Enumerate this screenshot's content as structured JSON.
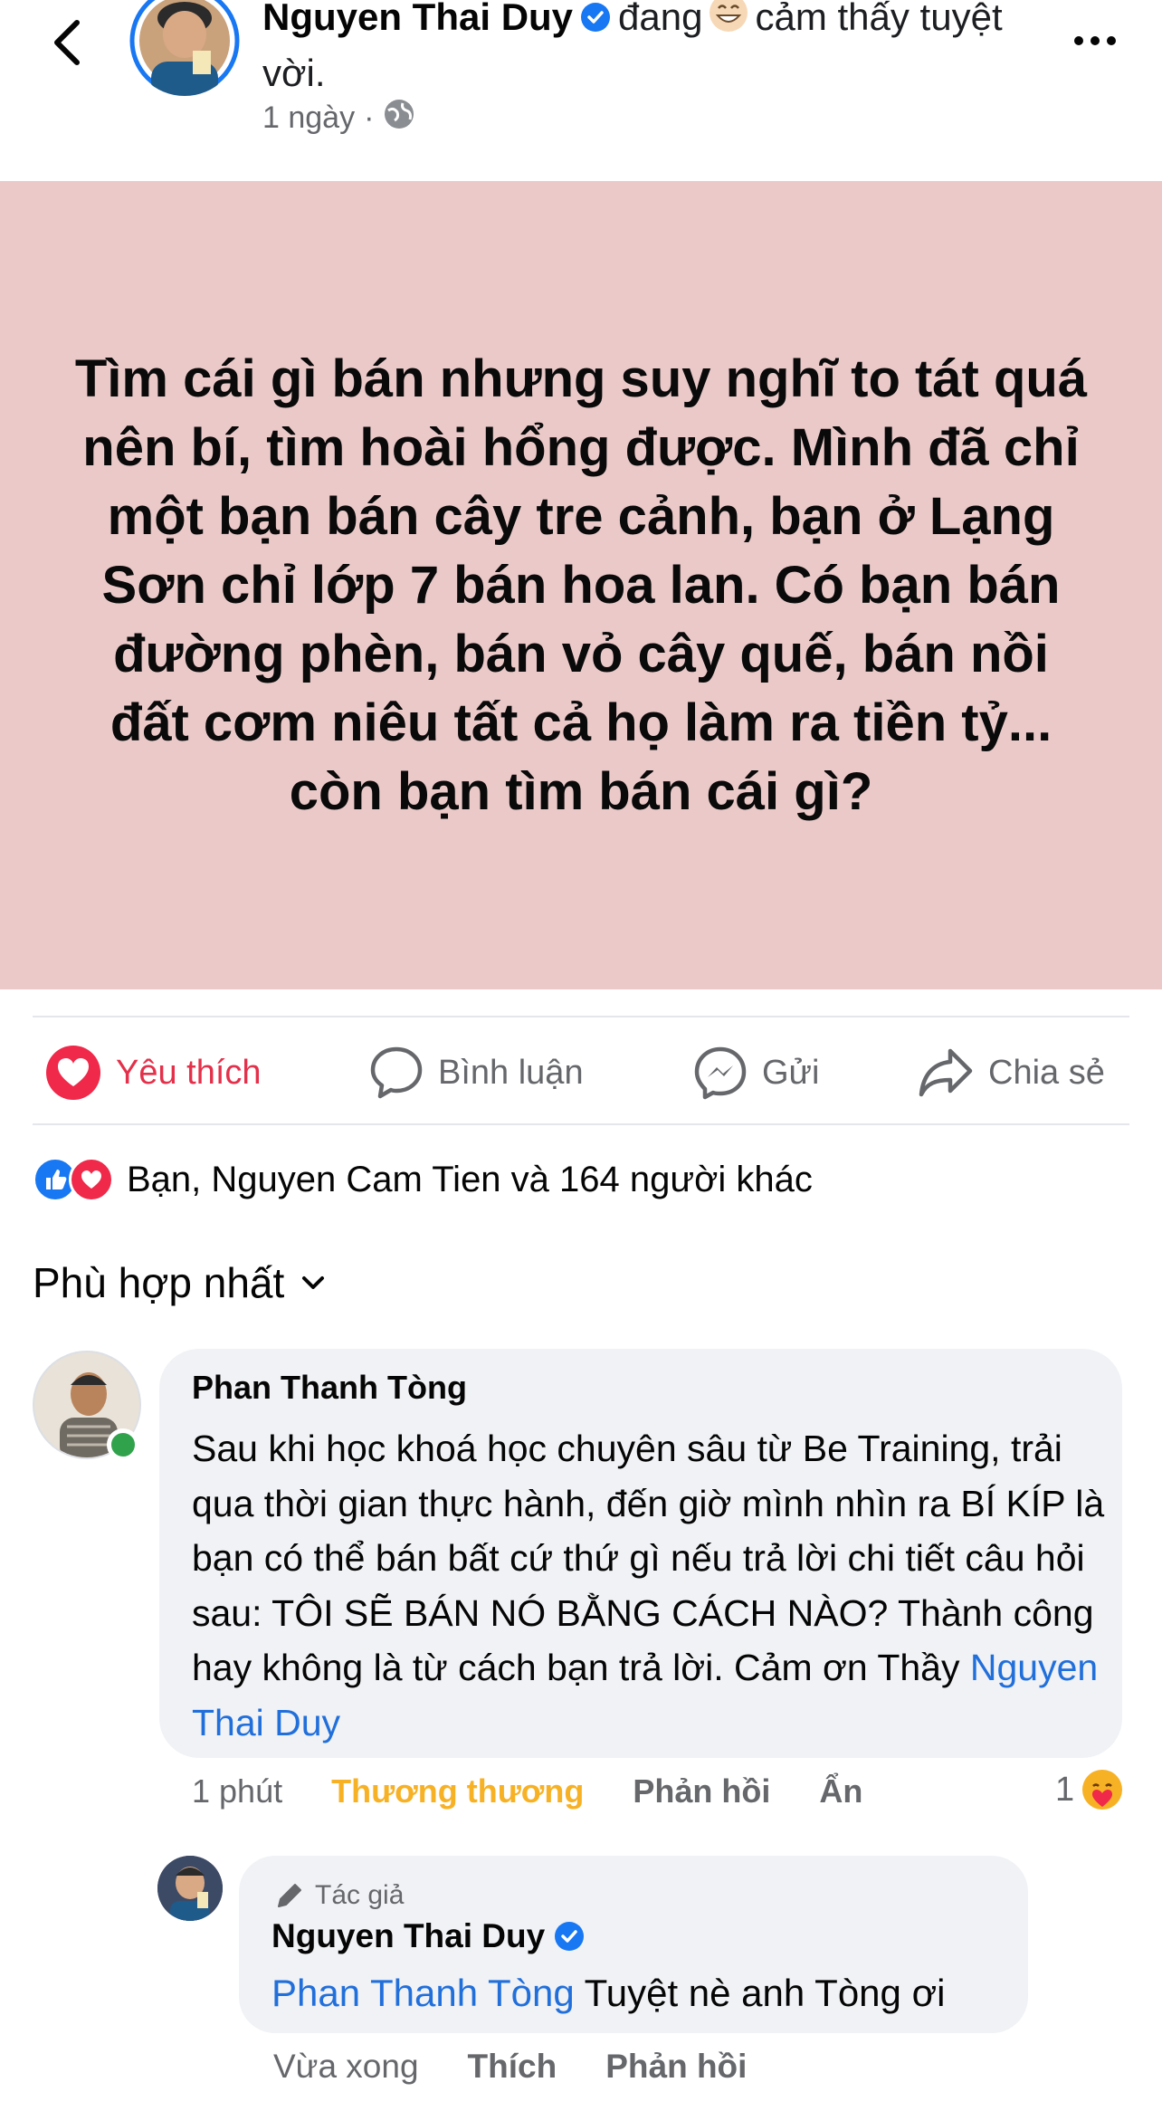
{
  "header": {
    "author_name": "Nguyen Thai Duy",
    "feeling_prefix": "đang",
    "feeling_text": "cảm thấy tuyệt vời.",
    "timestamp": "1 ngày",
    "privacy_icon": "globe-icon"
  },
  "post": {
    "text": "Tìm cái gì bán nhưng suy nghĩ to tát quá nên bí, tìm hoài hổng được. Mình đã chỉ một bạn bán cây tre cảnh, bạn ở Lạng Sơn chỉ lớp 7 bán hoa lan. Có bạn bán đường phèn, bán vỏ cây quế, bán nồi đất cơm niêu tất cả họ làm ra tiền tỷ... còn bạn tìm bán cái gì?",
    "background_color": "#ebc9c9"
  },
  "actions": {
    "like": "Yêu thích",
    "comment": "Bình luận",
    "send": "Gửi",
    "share": "Chia sẻ"
  },
  "reactions": {
    "summary": "Bạn, Nguyen Cam Tien và 164 người khác"
  },
  "sort": {
    "label": "Phù hợp nhất"
  },
  "comment": {
    "author": "Phan Thanh Tòng",
    "text": "Sau khi học khoá học chuyên sâu từ Be Training, trải qua thời gian thực hành, đến giờ mình nhìn ra BÍ KÍP là bạn có thể bán bất cứ thứ gì nếu trả lời chi tiết câu hỏi sau: TÔI SẼ BÁN NÓ BẰNG CÁCH NÀO? Thành công hay không là từ cách bạn trả lời. Cảm ơn Thầy ",
    "mention": "Nguyen Thai Duy",
    "time": "1 phút",
    "reaction_label": "Thương thương",
    "reply": "Phản hồi",
    "hide": "Ẩn",
    "reaction_count": "1"
  },
  "reply": {
    "badge": "Tác giả",
    "author": "Nguyen Thai Duy",
    "mention": "Phan Thanh Tòng",
    "text": " Tuyệt nè anh Tòng ơi",
    "time": "Vừa xong",
    "like": "Thích",
    "reply": "Phản hồi"
  },
  "colors": {
    "accent_blue": "#216fdb",
    "love_red": "#e4304a",
    "care_yellow": "#f7b125",
    "muted": "#65676b"
  }
}
